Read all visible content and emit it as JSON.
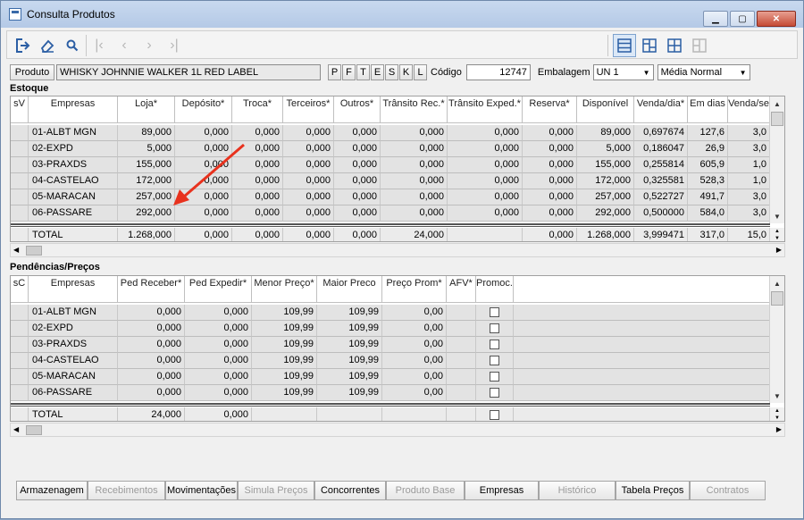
{
  "window": {
    "title": "Consulta Produtos"
  },
  "product": {
    "label": "Produto",
    "name": "WHISKY JOHNNIE WALKER 1L RED LABEL",
    "letters": [
      "P",
      "F",
      "T",
      "E",
      "S",
      "K",
      "L"
    ],
    "codigo_label": "Código",
    "codigo": "12747",
    "embalagem_label": "Embalagem",
    "embalagem": "UN  1",
    "media": "Média Normal"
  },
  "estoque": {
    "title": "Estoque",
    "columns": [
      "sV",
      "Empresas",
      "Loja*",
      "Depósito*",
      "Troca*",
      "Terceiros*",
      "Outros*",
      "Trânsito Rec.*",
      "Trânsito Exped.*",
      "Reserva*",
      "Disponível",
      "Venda/dia*",
      "Em dias",
      "Venda/se"
    ],
    "rows": [
      [
        "",
        "01-ALBT MGN",
        "89,000",
        "0,000",
        "0,000",
        "0,000",
        "0,000",
        "0,000",
        "0,000",
        "0,000",
        "89,000",
        "0,697674",
        "127,6",
        "3,0"
      ],
      [
        "",
        "02-EXPD",
        "5,000",
        "0,000",
        "0,000",
        "0,000",
        "0,000",
        "0,000",
        "0,000",
        "0,000",
        "5,000",
        "0,186047",
        "26,9",
        "3,0"
      ],
      [
        "",
        "03-PRAXDS",
        "155,000",
        "0,000",
        "0,000",
        "0,000",
        "0,000",
        "0,000",
        "0,000",
        "0,000",
        "155,000",
        "0,255814",
        "605,9",
        "1,0"
      ],
      [
        "",
        "04-CASTELAO",
        "172,000",
        "0,000",
        "0,000",
        "0,000",
        "0,000",
        "0,000",
        "0,000",
        "0,000",
        "172,000",
        "0,325581",
        "528,3",
        "1,0"
      ],
      [
        "",
        "05-MARACAN",
        "257,000",
        "0,000",
        "0,000",
        "0,000",
        "0,000",
        "0,000",
        "0,000",
        "0,000",
        "257,000",
        "0,522727",
        "491,7",
        "3,0"
      ],
      [
        "",
        "06-PASSARE",
        "292,000",
        "0,000",
        "0,000",
        "0,000",
        "0,000",
        "0,000",
        "0,000",
        "0,000",
        "292,000",
        "0,500000",
        "584,0",
        "3,0"
      ]
    ],
    "total": [
      "",
      "TOTAL",
      "1.268,000",
      "0,000",
      "0,000",
      "0,000",
      "0,000",
      "24,000",
      "",
      "0,000",
      "1.268,000",
      "3,999471",
      "317,0",
      "15,0"
    ]
  },
  "pendencias": {
    "title": "Pendências/Preços",
    "columns": [
      "sC",
      "Empresas",
      "Ped Receber*",
      "Ped Expedir*",
      "Menor Preço*",
      "Maior Preco",
      "Preço Prom*",
      "AFV*",
      "Promoc. PDV*"
    ],
    "rows": [
      [
        "",
        "01-ALBT MGN",
        "0,000",
        "0,000",
        "109,99",
        "109,99",
        "0,00",
        "",
        ""
      ],
      [
        "",
        "02-EXPD",
        "0,000",
        "0,000",
        "109,99",
        "109,99",
        "0,00",
        "",
        ""
      ],
      [
        "",
        "03-PRAXDS",
        "0,000",
        "0,000",
        "109,99",
        "109,99",
        "0,00",
        "",
        ""
      ],
      [
        "",
        "04-CASTELAO",
        "0,000",
        "0,000",
        "109,99",
        "109,99",
        "0,00",
        "",
        ""
      ],
      [
        "",
        "05-MARACAN",
        "0,000",
        "0,000",
        "109,99",
        "109,99",
        "0,00",
        "",
        ""
      ],
      [
        "",
        "06-PASSARE",
        "0,000",
        "0,000",
        "109,99",
        "109,99",
        "0,00",
        "",
        ""
      ]
    ],
    "total": [
      "",
      "TOTAL",
      "24,000",
      "0,000",
      "",
      "",
      "",
      "",
      ""
    ]
  },
  "bottom_tabs": [
    {
      "label": "Armazenagem",
      "enabled": true
    },
    {
      "label": "Recebimentos",
      "enabled": false
    },
    {
      "label": "Movimentações",
      "enabled": true
    },
    {
      "label": "Simula Preços",
      "enabled": false
    },
    {
      "label": "Concorrentes",
      "enabled": true
    },
    {
      "label": "Produto Base",
      "enabled": false
    },
    {
      "label": "Empresas",
      "enabled": true
    },
    {
      "label": "Histórico",
      "enabled": false
    },
    {
      "label": "Tabela Preços",
      "enabled": true
    },
    {
      "label": "Contratos",
      "enabled": false
    }
  ],
  "colors": {
    "annotation_arrow": "#e8321e",
    "accent": "#2b5ea4"
  }
}
